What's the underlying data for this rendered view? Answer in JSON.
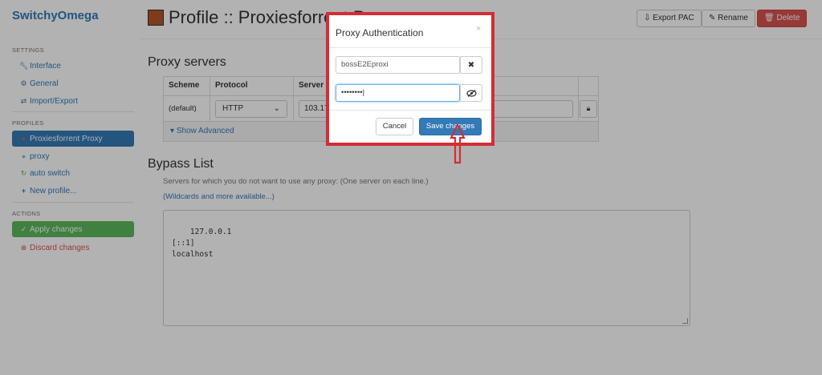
{
  "app": {
    "name": "SwitchyOmega"
  },
  "sidebar": {
    "settings_header": "SETTINGS",
    "settings": [
      {
        "label": "Interface",
        "icon": "wrench-icon"
      },
      {
        "label": "General",
        "icon": "gear-icon"
      },
      {
        "label": "Import/Export",
        "icon": "import-export-icon"
      }
    ],
    "profiles_header": "PROFILES",
    "profiles": [
      {
        "label": "Proxiesforrent Proxy",
        "icon": "globe-icon",
        "active": true
      },
      {
        "label": "proxy",
        "icon": "globe-icon"
      },
      {
        "label": "auto switch",
        "icon": "switch-icon"
      },
      {
        "label": "New profile...",
        "icon": "plus-icon"
      }
    ],
    "actions_header": "ACTIONS",
    "actions": [
      {
        "label": "Apply changes",
        "icon": "check-circle-icon"
      },
      {
        "label": "Discard changes",
        "icon": "x-circle-icon"
      }
    ]
  },
  "header": {
    "title": "Profile :: Proxiesforrent P",
    "profile_color": "#b5552a",
    "export_label": "Export PAC",
    "rename_label": "Rename",
    "delete_label": "Delete"
  },
  "proxy_servers": {
    "title": "Proxy servers",
    "columns": [
      "Scheme",
      "Protocol",
      "Server"
    ],
    "row": {
      "scheme": "(default)",
      "protocol": "HTTP",
      "server": "103.17"
    },
    "show_advanced": "Show Advanced"
  },
  "bypass": {
    "title": "Bypass List",
    "description": "Servers for which you do not want to use any proxy: (One server on each line.)",
    "link": "(Wildcards and more available...)",
    "text": "127.0.0.1\n[::1]\nlocalhost"
  },
  "dialog": {
    "title": "Proxy Authentication",
    "close": "×",
    "username_value": "bossE2Eproxi",
    "password_value": "••••••••|",
    "cancel_label": "Cancel",
    "save_label": "Save changes"
  },
  "colors": {
    "accent": "#337ab7",
    "danger": "#d9534f",
    "success": "#5cb85c",
    "highlight": "#d42d35"
  }
}
